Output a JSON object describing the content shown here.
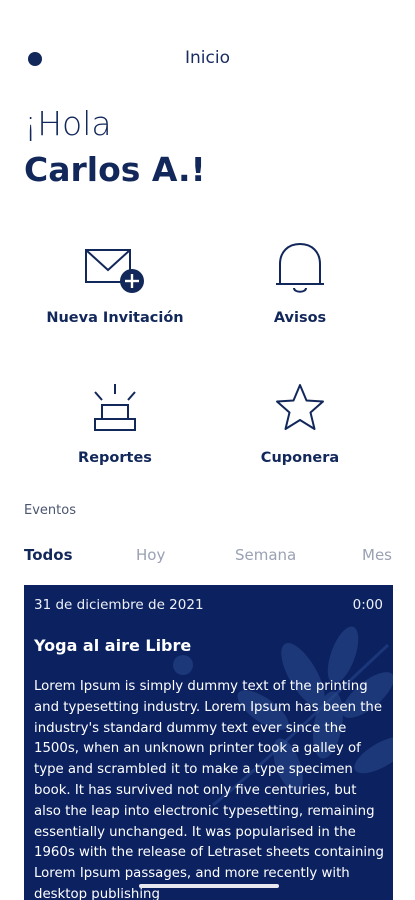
{
  "header": {
    "title": "Inicio"
  },
  "greeting": {
    "line1": "¡Hola",
    "line2": "Carlos A.!"
  },
  "actions": [
    {
      "label": "Nueva Invitación",
      "icon": "envelope-plus-icon"
    },
    {
      "label": "Avisos",
      "icon": "bell-icon"
    },
    {
      "label": "Reportes",
      "icon": "alarm-light-icon"
    },
    {
      "label": "Cuponera",
      "icon": "star-icon"
    }
  ],
  "events": {
    "title": "Eventos",
    "tabs": [
      "Todos",
      "Hoy",
      "Semana",
      "Mes"
    ],
    "active_tab": "Todos",
    "card": {
      "date": "31 de diciembre de 2021",
      "time": "0:00",
      "title": "Yoga al aire Libre",
      "body": "Lorem Ipsum is simply dummy text of the printing and typesetting industry. Lorem Ipsum has been the industry's standard dummy text ever since the 1500s, when an unknown printer took a galley of type and scrambled it to make a type specimen book. It has survived not only five centuries, but also the leap into electronic typesetting, remaining essentially unchanged. It was popularised in the 1960s with the release of Letraset sheets containing Lorem Ipsum passages, and more recently with desktop publishing"
    }
  },
  "colors": {
    "primary": "#12275a",
    "card_bg": "#0b2160",
    "tab_inactive": "#9aa1b3"
  }
}
